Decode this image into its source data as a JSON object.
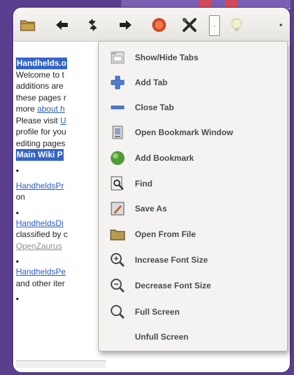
{
  "content": {
    "heading": "Handhelds.o",
    "lines": [
      {
        "text": "Welcome to t",
        "style": "plain"
      },
      {
        "text": "additions are",
        "style": "plain"
      },
      {
        "text": "these pages r",
        "style": "plain"
      },
      {
        "pre": "more ",
        "link": "about h"
      },
      {
        "pre": "Please visit ",
        "link": "U"
      },
      {
        "text": "profile for you",
        "style": "plain"
      },
      {
        "text": "editing pages",
        "style": "plain"
      }
    ],
    "main_wiki": "Main Wiki P",
    "entries": [
      {
        "link": "HandheldsPr",
        "after": "on"
      },
      {
        "link": "HandheldsDi",
        "after": "classified by c",
        "dim": "OpenZaurus"
      },
      {
        "link": "HandheldsPe",
        "after": "and other iter"
      }
    ]
  },
  "menu": {
    "items": [
      {
        "label": "Show/Hide Tabs",
        "icon": "tabs-icon"
      },
      {
        "label": "Add Tab",
        "icon": "plus-icon"
      },
      {
        "label": "Close Tab",
        "icon": "minus-icon"
      },
      {
        "label": "Open Bookmark Window",
        "icon": "bookmark-window-icon"
      },
      {
        "label": "Add Bookmark",
        "icon": "green-ball-icon"
      },
      {
        "label": "Find",
        "icon": "find-icon"
      },
      {
        "label": "Save As",
        "icon": "save-as-icon"
      },
      {
        "label": "Open From File",
        "icon": "folder-icon"
      },
      {
        "label": "Increase Font Size",
        "icon": "zoom-in-icon"
      },
      {
        "label": "Decrease Font Size",
        "icon": "zoom-out-icon"
      },
      {
        "label": "Full Screen",
        "icon": "full-screen-icon"
      },
      {
        "label": "Unfull Screen",
        "icon": ""
      }
    ]
  },
  "toolbar": {
    "dropdown_glyph": "·"
  },
  "colors": {
    "accent": "#3465c8",
    "link": "#2a5cbf",
    "background": "#5a3f8e"
  }
}
